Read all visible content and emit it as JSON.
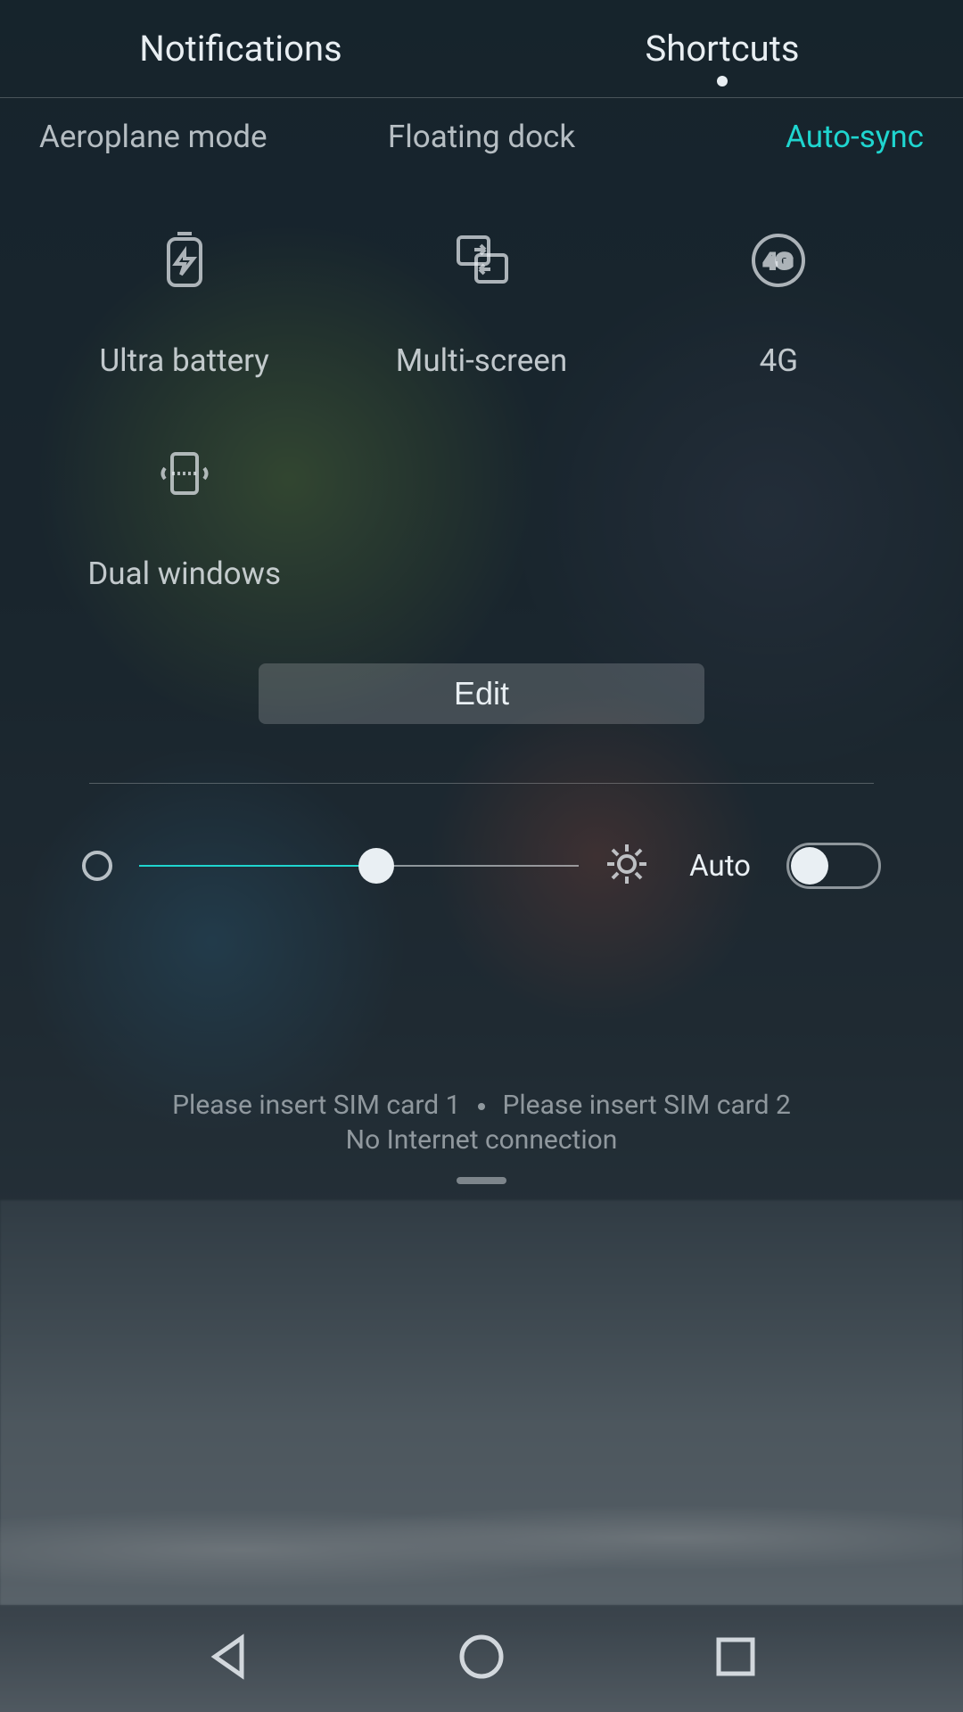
{
  "tabs": {
    "notifications": "Notifications",
    "shortcuts": "Shortcuts",
    "active": "shortcuts"
  },
  "label_row": {
    "left": "Aeroplane mode",
    "center": "Floating dock",
    "right": "Auto-sync",
    "right_active": true
  },
  "tiles": [
    {
      "id": "ultra-battery",
      "label": "Ultra battery",
      "icon": "battery-icon"
    },
    {
      "id": "multi-screen",
      "label": "Multi-screen",
      "icon": "multiscreen-icon"
    },
    {
      "id": "4g",
      "label": "4G",
      "icon": "fourg-icon"
    },
    {
      "id": "dual-windows",
      "label": "Dual windows",
      "icon": "dualwindows-icon"
    }
  ],
  "edit_button": "Edit",
  "brightness": {
    "percent": 54,
    "auto_label": "Auto",
    "auto_on": false
  },
  "status": {
    "sim1": "Please insert SIM card 1",
    "sim2": "Please insert SIM card 2",
    "net": "No Internet connection"
  },
  "colors": {
    "accent": "#1fd5cf"
  }
}
